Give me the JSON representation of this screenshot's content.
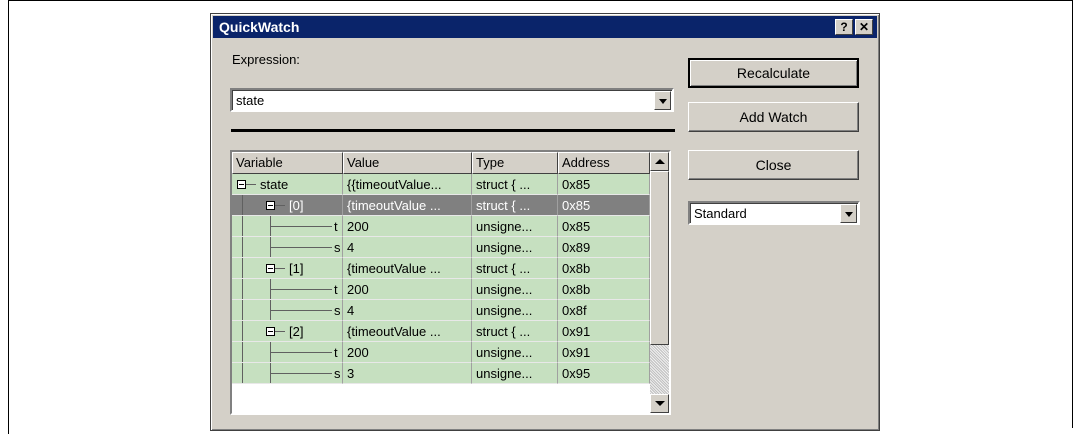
{
  "dialog": {
    "title": "QuickWatch",
    "help_glyph": "?",
    "close_glyph": "✕"
  },
  "expression": {
    "label": "Expression:",
    "value": "state"
  },
  "buttons": {
    "recalculate": "Recalculate",
    "add_watch": "Add Watch",
    "close": "Close"
  },
  "format_select": {
    "value": "Standard"
  },
  "grid": {
    "columns": [
      "Variable",
      "Value",
      "Type",
      "Address"
    ],
    "rows": [
      {
        "name": "state",
        "value": "{{timeoutValue...",
        "type": "struct { ...",
        "address": "0x85"
      },
      {
        "name": "[0]",
        "value": "{timeoutValue ...",
        "type": "struct { ...",
        "address": "0x85",
        "selected": true
      },
      {
        "name": "t",
        "value": "200",
        "type": "unsigne...",
        "address": "0x85"
      },
      {
        "name": "s",
        "value": "4",
        "type": "unsigne...",
        "address": "0x89"
      },
      {
        "name": "[1]",
        "value": "{timeoutValue ...",
        "type": "struct { ...",
        "address": "0x8b"
      },
      {
        "name": "t",
        "value": "200",
        "type": "unsigne...",
        "address": "0x8b"
      },
      {
        "name": "s",
        "value": "4",
        "type": "unsigne...",
        "address": "0x8f"
      },
      {
        "name": "[2]",
        "value": "{timeoutValue ...",
        "type": "struct { ...",
        "address": "0x91"
      },
      {
        "name": "t",
        "value": "200",
        "type": "unsigne...",
        "address": "0x91"
      },
      {
        "name": "s",
        "value": "3",
        "type": "unsigne...",
        "address": "0x95"
      }
    ]
  },
  "colors": {
    "row_background": "#c6e0c0",
    "selected_row": "#808080",
    "title_bar": "#0a246a",
    "dialog_face": "#d4d0c8"
  }
}
